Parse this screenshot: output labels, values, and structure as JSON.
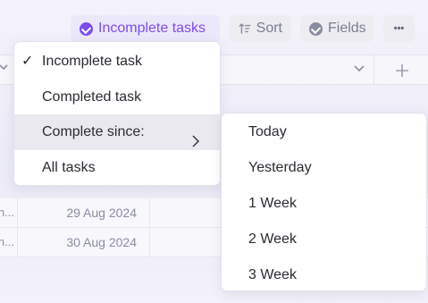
{
  "toolbar": {
    "filter_label": "Incomplete tasks",
    "sort_label": "Sort",
    "fields_label": "Fields",
    "more_label": "•••"
  },
  "rows": [
    {
      "name": "n...",
      "date": "29 Aug 2024"
    },
    {
      "name": "n...",
      "date": "30 Aug 2024"
    }
  ],
  "filter_menu": {
    "items": [
      {
        "label": "Incomplete task",
        "checked": true
      },
      {
        "label": "Completed task"
      },
      {
        "label": "Complete since:",
        "has_submenu": true
      },
      {
        "label": "All tasks"
      }
    ]
  },
  "complete_since_menu": {
    "items": [
      {
        "label": "Today"
      },
      {
        "label": "Yesterday"
      },
      {
        "label": "1 Week"
      },
      {
        "label": "2 Week"
      },
      {
        "label": "3 Week"
      }
    ]
  },
  "colors": {
    "accent": "#7c4dea",
    "accent_bg": "#ece8fb",
    "button_bg": "#ededf1",
    "hover_bg": "#e9e9ef"
  },
  "icons": {
    "check": "check-circle-icon",
    "sort": "sort-icon",
    "fields": "check-circle-icon",
    "more": "more-horizontal-icon",
    "chevron": "chevron-right-icon"
  }
}
